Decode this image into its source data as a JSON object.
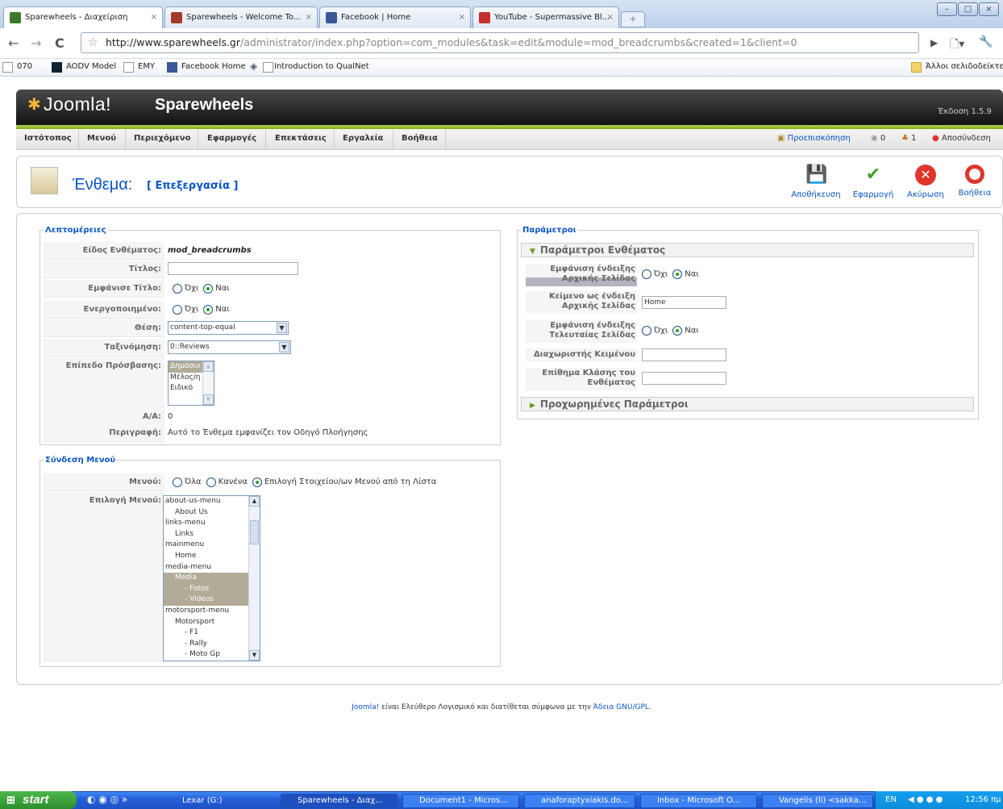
{
  "browser": {
    "tabs": [
      {
        "label": "Sparewheels - Διαχείριση",
        "active": true
      },
      {
        "label": "Sparewheels - Welcome To...",
        "active": false
      },
      {
        "label": "Facebook | Home",
        "active": false
      },
      {
        "label": "YouTube - Supermassive Bl...",
        "active": false
      }
    ],
    "url_host": "http://www.sparewheels.gr",
    "url_path": "/administrator/index.php?option=com_modules&task=edit&module=mod_breadcrumbs&created=1&client=0",
    "bookmarks": [
      "070",
      "AODV Model",
      "EMY",
      "Facebook Home",
      "Introduction to QualNet"
    ],
    "other_bookmarks": "Άλλοι σελιδοδείκτε"
  },
  "joomla": {
    "logo": "Joomla!",
    "site": "Sparewheels",
    "version": "Έκδοση 1.5.9",
    "menu": [
      "Ιστότοπος",
      "Μενού",
      "Περιεχόμενο",
      "Εφαρμογές",
      "Επεκτάσεις",
      "Εργαλεία",
      "Βοήθεια"
    ],
    "preview": "Προεπισκόπηση",
    "messages_count": "0",
    "users_count": "1",
    "logout": "Αποσύνδεση"
  },
  "toolbar": {
    "title": "Ένθεμα:",
    "subtitle": "[ Επεξεργασία ]",
    "save": "Αποθήκευση",
    "apply": "Εφαρμογή",
    "cancel": "Ακύρωση",
    "help": "Βοήθεια"
  },
  "details": {
    "legend": "Λεπτομέρειες",
    "type_label": "Είδος Ενθέματος:",
    "type_value": "mod_breadcrumbs",
    "title_label": "Τίτλος:",
    "title_value": "",
    "show_title_label": "Εμφάνισε Τίτλο:",
    "enabled_label": "Ενεργοποιημένο:",
    "no": "Όχι",
    "yes": "Ναι",
    "position_label": "Θέση:",
    "position_value": "content-top-equal",
    "order_label": "Ταξινόμηση:",
    "order_value": "0::Reviews",
    "access_label": "Επίπεδο Πρόσβασης:",
    "access_options": [
      "Δημόσιο",
      "Μέλος/η",
      "Ειδικό"
    ],
    "id_label": "Α/Α:",
    "id_value": "0",
    "desc_label": "Περιγραφή:",
    "desc_value": "Αυτό το Ένθεμα εμφανίζει τον Οδηγό Πλοήγησης"
  },
  "menu_assign": {
    "legend": "Σύνδεση Μενού",
    "menus_label": "Μενού:",
    "opt_all": "Όλα",
    "opt_none": "Κανένα",
    "opt_select": "Επιλογή Στοιχείου/ων Μενού από τη Λίστα",
    "select_label": "Επιλογή Μενού:",
    "items": [
      {
        "text": "about-us-menu",
        "indent": 0,
        "selected": false
      },
      {
        "text": "About Us",
        "indent": 1,
        "selected": false
      },
      {
        "text": "links-menu",
        "indent": 0,
        "selected": false
      },
      {
        "text": "Links",
        "indent": 1,
        "selected": false
      },
      {
        "text": "mainmenu",
        "indent": 0,
        "selected": false
      },
      {
        "text": "Home",
        "indent": 1,
        "selected": false
      },
      {
        "text": "media-menu",
        "indent": 0,
        "selected": false
      },
      {
        "text": "Media",
        "indent": 1,
        "selected": true
      },
      {
        "text": "- Fotos",
        "indent": 2,
        "selected": true
      },
      {
        "text": "- Videos",
        "indent": 2,
        "selected": true
      },
      {
        "text": "motorsport-menu",
        "indent": 0,
        "selected": false
      },
      {
        "text": "Motorsport",
        "indent": 1,
        "selected": false
      },
      {
        "text": "- F1",
        "indent": 2,
        "selected": false
      },
      {
        "text": "- Rally",
        "indent": 2,
        "selected": false
      },
      {
        "text": "- Moto Gp",
        "indent": 2,
        "selected": false
      }
    ]
  },
  "params": {
    "legend": "Παράμετροι",
    "module_params": "Παράμετροι Ενθέματος",
    "show_home_label": "Εμφάνιση ένδειξης Αρχικής Σελίδας",
    "home_text_label": "Κείμενο ως ένδειξη Αρχικής Σελίδας",
    "home_text_value": "Home",
    "show_last_label": "Εμφάνιση ένδειξης Τελευταίας Σελίδας",
    "separator_label": "Διαχωριστής Κειμένου",
    "separator_value": "",
    "suffix_label": "Επίθημα Κλάσης του Ενθέματος",
    "suffix_value": "",
    "advanced": "Προχωρημένες Παράμετροι"
  },
  "footer": {
    "link": "Joomla!",
    "text": " είναι Ελεύθερο Λογισμικό και διατίθεται σύμφωνα με την ",
    "license": "Άδεια GNU/GPL",
    "end": "."
  },
  "taskbar": {
    "start": "start",
    "items": [
      "Lexar (G:)",
      "Sparewheels - Διαχ...",
      "Document1 - Micros...",
      "anaforaptyxiakis.do...",
      "Inbox - Microsoft O...",
      "Vangelis (li) <sakka..."
    ],
    "lang": "EN",
    "clock": "12:56 πμ"
  },
  "colors": {
    "joomla_blue": "#0b55c4",
    "joomla_green": "#7fab19",
    "selected_item": "#b1ab98"
  }
}
